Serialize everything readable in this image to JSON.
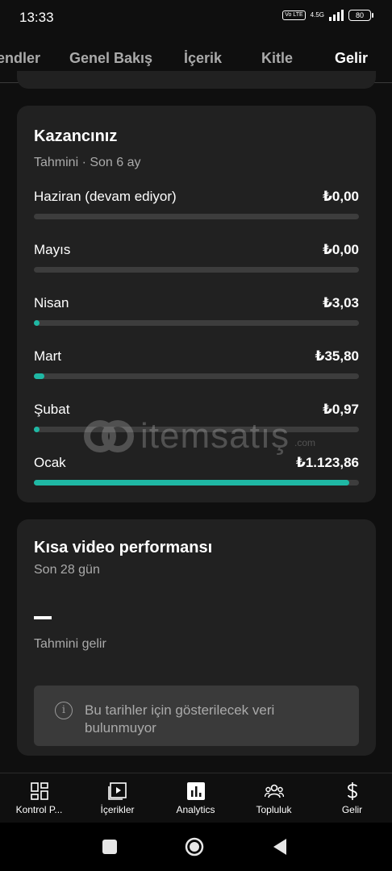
{
  "status_bar": {
    "time": "13:33",
    "volte": "Vo LTE",
    "network": "4.5G",
    "battery": "80"
  },
  "tabs": [
    {
      "label": "endler"
    },
    {
      "label": "Genel Bakış"
    },
    {
      "label": "İçerik"
    },
    {
      "label": "Kitle"
    },
    {
      "label": "Gelir"
    }
  ],
  "active_tab": "Gelir",
  "earnings_card": {
    "title": "Kazancınız",
    "subtitle": "Tahmini · Son 6 ay",
    "rows": [
      {
        "month": "Haziran (devam ediyor)",
        "value": "₺0,00",
        "fraction": 0.0
      },
      {
        "month": "Mayıs",
        "value": "₺0,00",
        "fraction": 0.0
      },
      {
        "month": "Nisan",
        "value": "₺3,03",
        "fraction": 0.003
      },
      {
        "month": "Mart",
        "value": "₺35,80",
        "fraction": 0.032
      },
      {
        "month": "Şubat",
        "value": "₺0,97",
        "fraction": 0.001
      },
      {
        "month": "Ocak",
        "value": "₺1.123,86",
        "fraction": 0.97
      }
    ],
    "accent_color": "#1fb8a4"
  },
  "watermark": {
    "text": "itemsatış",
    "domain": ".com"
  },
  "short_video_card": {
    "title": "Kısa video performansı",
    "subtitle": "Son 28 gün",
    "metric_value": "—",
    "metric_label": "Tahmini gelir",
    "info_message": "Bu tarihler için gösterilecek veri bulunmuyor"
  },
  "bottom_nav": [
    {
      "label": "Kontrol P...",
      "icon": "dashboard-icon"
    },
    {
      "label": "İçerikler",
      "icon": "content-icon"
    },
    {
      "label": "Analytics",
      "icon": "analytics-icon"
    },
    {
      "label": "Topluluk",
      "icon": "community-icon"
    },
    {
      "label": "Gelir",
      "icon": "earn-icon"
    }
  ]
}
